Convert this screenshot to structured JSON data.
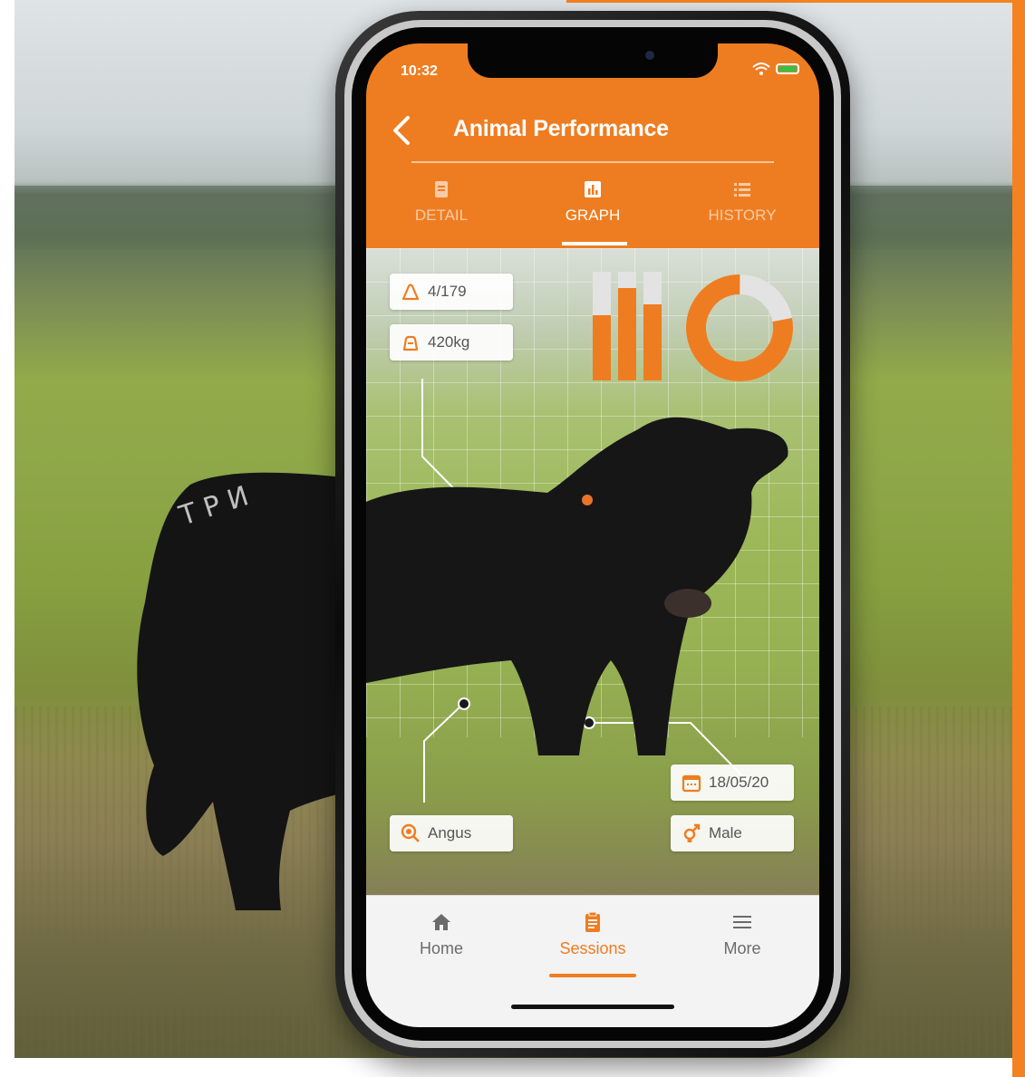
{
  "status_bar": {
    "time": "10:32"
  },
  "header": {
    "title": "Animal Performance"
  },
  "tabs": [
    {
      "label": "DETAIL",
      "icon": "document-icon",
      "active": false
    },
    {
      "label": "GRAPH",
      "icon": "bar-chart-icon",
      "active": true
    },
    {
      "label": "HISTORY",
      "icon": "list-icon",
      "active": false
    }
  ],
  "stats": {
    "rank": {
      "icon": "triangle-icon",
      "value": "4/179"
    },
    "weight": {
      "icon": "scale-icon",
      "value": "420kg"
    },
    "breed": {
      "icon": "magnifier-icon",
      "value": "Angus"
    },
    "date": {
      "icon": "calendar-icon",
      "value": "18/05/20"
    },
    "sex": {
      "icon": "gender-icon",
      "value": "Male"
    }
  },
  "decor_chart": {
    "bar_fill_fractions": [
      0.6,
      0.85,
      0.7
    ],
    "donut_fill_fraction": 0.78
  },
  "bottom_nav": [
    {
      "label": "Home",
      "icon": "home-icon",
      "active": false
    },
    {
      "label": "Sessions",
      "icon": "clipboard-icon",
      "active": true
    },
    {
      "label": "More",
      "icon": "menu-icon",
      "active": false
    }
  ],
  "colors": {
    "brand_orange": "#ee7d21",
    "frame_orange": "#f58220",
    "nav_inactive": "#6b6b6b"
  }
}
